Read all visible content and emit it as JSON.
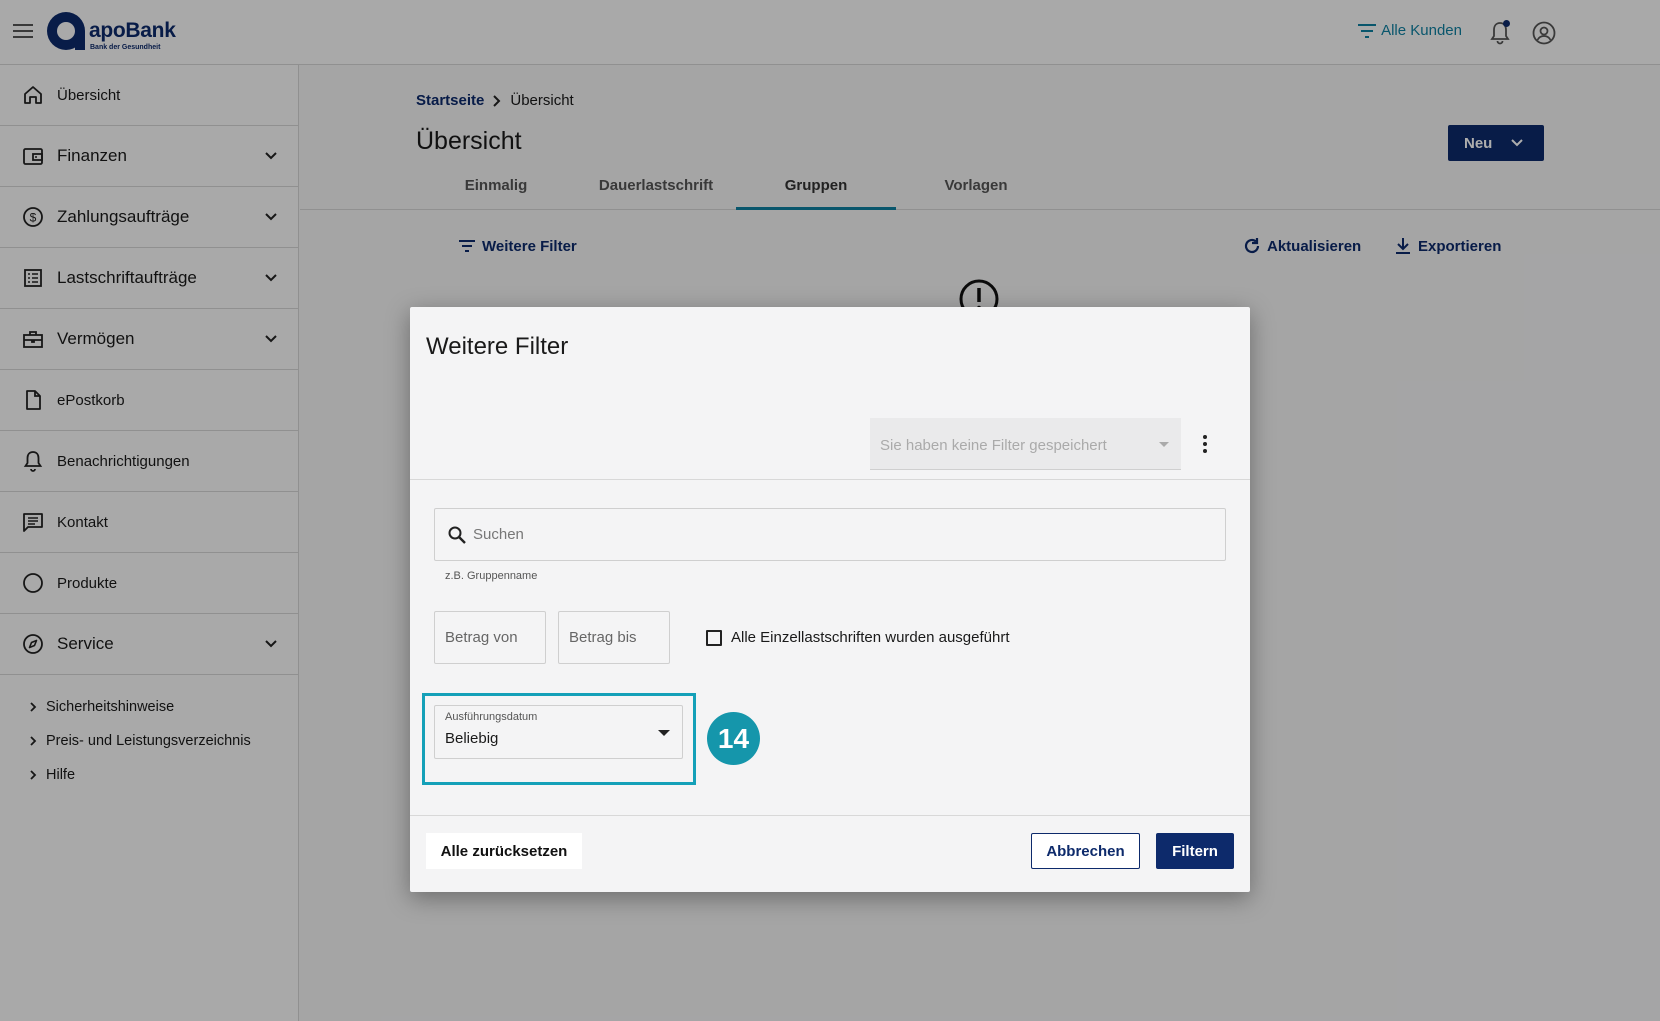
{
  "header": {
    "brand_name": "apoBank",
    "brand_tagline": "Bank der Gesundheit",
    "customer_filter_label": "Alle Kunden"
  },
  "sidebar": {
    "items": [
      {
        "label": "Übersicht",
        "icon": "home-icon",
        "expandable": false
      },
      {
        "label": "Finanzen",
        "icon": "wallet-icon",
        "expandable": true
      },
      {
        "label": "Zahlungsaufträge",
        "icon": "dollar-circle-icon",
        "expandable": true
      },
      {
        "label": "Lastschriftaufträge",
        "icon": "list-icon",
        "expandable": true
      },
      {
        "label": "Vermögen",
        "icon": "briefcase-icon",
        "expandable": true
      },
      {
        "label": "ePostkorb",
        "icon": "document-icon",
        "expandable": false
      },
      {
        "label": "Benachrichtigungen",
        "icon": "bell-icon",
        "expandable": false
      },
      {
        "label": "Kontakt",
        "icon": "chat-icon",
        "expandable": false
      },
      {
        "label": "Produkte",
        "icon": "circle-icon",
        "expandable": false
      },
      {
        "label": "Service",
        "icon": "compass-icon",
        "expandable": true
      }
    ],
    "links": [
      "Sicherheitshinweise",
      "Preis- und Leistungsverzeichnis",
      "Hilfe"
    ]
  },
  "breadcrumb": {
    "home": "Startseite",
    "current": "Übersicht"
  },
  "page": {
    "title": "Übersicht",
    "new_button": "Neu",
    "tabs": [
      "Einmalig",
      "Dauerlastschrift",
      "Gruppen",
      "Vorlagen"
    ],
    "active_tab": "Gruppen",
    "more_filters": "Weitere Filter",
    "refresh": "Aktualisieren",
    "export": "Exportieren"
  },
  "dialog": {
    "title": "Weitere Filter",
    "saved_filters_placeholder": "Sie haben keine Filter gespeichert",
    "search_placeholder": "Suchen",
    "search_hint": "z.B. Gruppenname",
    "amount_from_placeholder": "Betrag von",
    "amount_to_placeholder": "Betrag bis",
    "all_executed_label": "Alle Einzellastschriften wurden ausgeführt",
    "date_label": "Ausführungsdatum",
    "date_value": "Beliebig",
    "step_number": "14",
    "reset_button": "Alle zurücksetzen",
    "cancel_button": "Abbrechen",
    "filter_button": "Filtern"
  },
  "colors": {
    "brand_navy": "#0d2a6b",
    "accent_teal": "#0e7fa0",
    "highlight": "#14a0b8",
    "step_badge": "#1596ab"
  }
}
